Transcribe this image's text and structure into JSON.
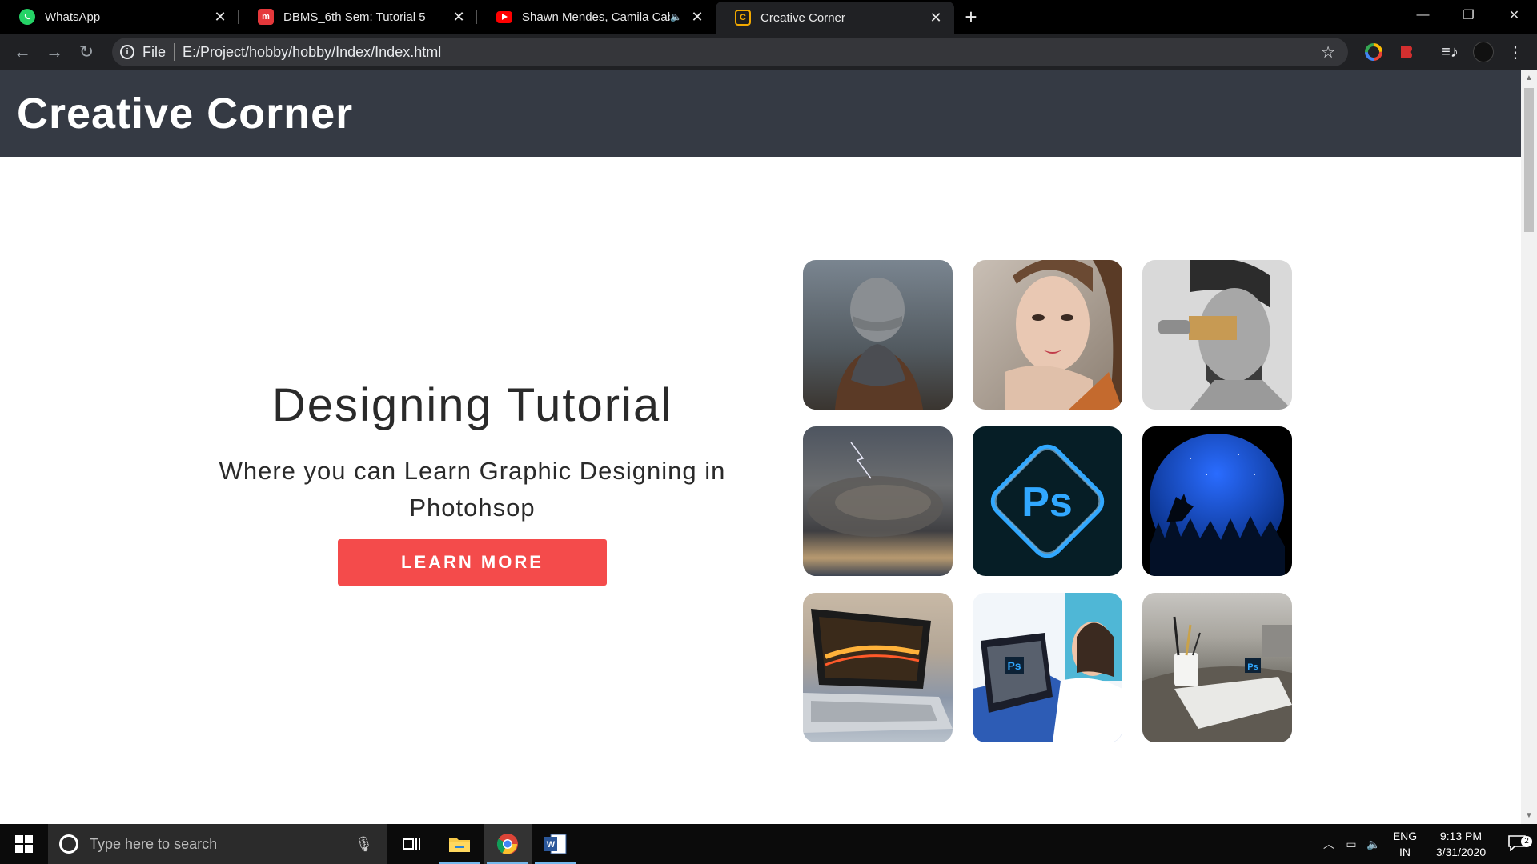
{
  "browser": {
    "tabs": [
      {
        "title": "WhatsApp",
        "favicon_color": "#25d366",
        "favicon": "whatsapp-icon"
      },
      {
        "title": "DBMS_6th Sem: Tutorial 5",
        "favicon_color": "#e5383b",
        "favicon_letter": "m"
      },
      {
        "title": "Shawn Mendes, Camila Cabe",
        "favicon_color": "#ff0000",
        "favicon": "youtube-icon"
      },
      {
        "title": "Creative Corner",
        "favicon_color": "#f2a900",
        "favicon_letter": "C"
      }
    ],
    "address": {
      "scheme_label": "File",
      "url": "E:/Project/hobby/hobby/Index/Index.html"
    }
  },
  "page": {
    "header_title": "Creative Corner",
    "hero": {
      "heading": "Designing Tutorial",
      "subtitle": "Where you can Learn Graphic Designing in Photohsop",
      "cta_label": "LEARN MORE"
    },
    "gallery": [
      {
        "name": "beanie-person-photo"
      },
      {
        "name": "woman-portrait-photo"
      },
      {
        "name": "man-with-brush-photo"
      },
      {
        "name": "storm-clouds-photo"
      },
      {
        "name": "photoshop-express-logo",
        "logo_text": "Ps"
      },
      {
        "name": "wolf-moon-illustration"
      },
      {
        "name": "laptop-photo"
      },
      {
        "name": "designer-illustration",
        "logo_text": "Ps"
      },
      {
        "name": "desk-pencils-photo",
        "logo_text": "Ps"
      }
    ]
  },
  "taskbar": {
    "search_placeholder": "Type here to search",
    "lang": "ENG",
    "region": "IN",
    "time": "9:13 PM",
    "date": "3/31/2020",
    "notification_count": "2"
  }
}
